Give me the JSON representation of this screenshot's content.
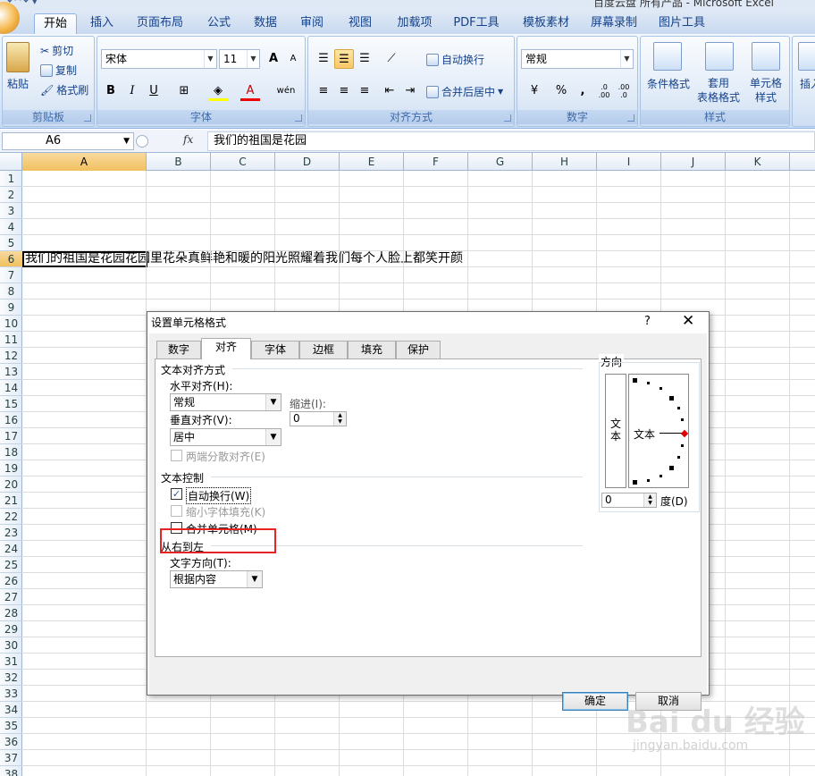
{
  "window": {
    "title_partial": "百度云盘 所有产品 - Microsoft Excel"
  },
  "ribbon_tabs": [
    "开始",
    "插入",
    "页面布局",
    "公式",
    "数据",
    "审阅",
    "视图",
    "加载项",
    "PDF工具",
    "模板素材",
    "屏幕录制",
    "图片工具"
  ],
  "ribbon": {
    "clipboard": {
      "label": "剪贴板",
      "paste": "粘贴",
      "cut": "剪切",
      "copy": "复制",
      "format_painter": "格式刷"
    },
    "font": {
      "label": "字体",
      "name": "宋体",
      "size": "11",
      "bold": "B",
      "italic": "I",
      "underline": "U",
      "grow": "A",
      "shrink": "A",
      "phonetic": "wén"
    },
    "alignment": {
      "label": "对齐方式",
      "wrap_text": "自动换行",
      "merge_center": "合并后居中"
    },
    "number": {
      "label": "数字",
      "format": "常规",
      "percent": "%",
      "comma": ",",
      "inc_decimal": ".0\n.00",
      "dec_decimal": ".00\n.0"
    },
    "styles": {
      "label": "样式",
      "conditional": "条件格式",
      "table": "套用\n表格格式",
      "cell": "单元格\n样式"
    },
    "insert": {
      "label": "插入"
    }
  },
  "formula_bar": {
    "name_box": "A6",
    "fx": "fx",
    "content": "我们的祖国是花园"
  },
  "grid": {
    "columns": [
      "A",
      "B",
      "C",
      "D",
      "E",
      "F",
      "G",
      "H",
      "I",
      "J",
      "K"
    ],
    "rows": [
      "1",
      "2",
      "3",
      "4",
      "5",
      "6",
      "7",
      "8",
      "9",
      "10",
      "11",
      "12",
      "13",
      "14",
      "15",
      "16",
      "17",
      "18",
      "19",
      "20",
      "21",
      "22",
      "23",
      "24",
      "25",
      "26",
      "27",
      "28",
      "29",
      "30",
      "31",
      "32",
      "33",
      "34",
      "35",
      "36",
      "37",
      "38"
    ],
    "selected_cell": "A6",
    "a6_text": "我们的祖国是花园花园里花朵真鲜艳和暖的阳光照耀着我们每个人脸上都笑开颜"
  },
  "dialog": {
    "title": "设置单元格格式",
    "help": "?",
    "close": "✕",
    "tabs": [
      "数字",
      "对齐",
      "字体",
      "边框",
      "填充",
      "保护"
    ],
    "active_tab": "对齐",
    "text_alignment": {
      "section": "文本对齐方式",
      "horizontal_label": "水平对齐(H):",
      "horizontal_value": "常规",
      "indent_label": "缩进(I):",
      "indent_value": "0",
      "vertical_label": "垂直对齐(V):",
      "vertical_value": "居中",
      "justify_distributed": "两端分散对齐(E)"
    },
    "text_control": {
      "section": "文本控制",
      "wrap_text": "自动换行(W)",
      "wrap_checked": true,
      "shrink_to_fit": "缩小字体填充(K)",
      "merge_cells": "合并单元格(M)"
    },
    "rtl": {
      "section": "从右到左",
      "direction_label": "文字方向(T):",
      "direction_value": "根据内容"
    },
    "orientation": {
      "section": "方向",
      "vertical_text": "文\n本",
      "dial_text": "文本",
      "degrees_value": "0",
      "degrees_label": "度(D)"
    },
    "ok": "确定",
    "cancel": "取消"
  },
  "watermark": {
    "logo": "Bai du 经验",
    "url": "jingyan.baidu.com"
  }
}
